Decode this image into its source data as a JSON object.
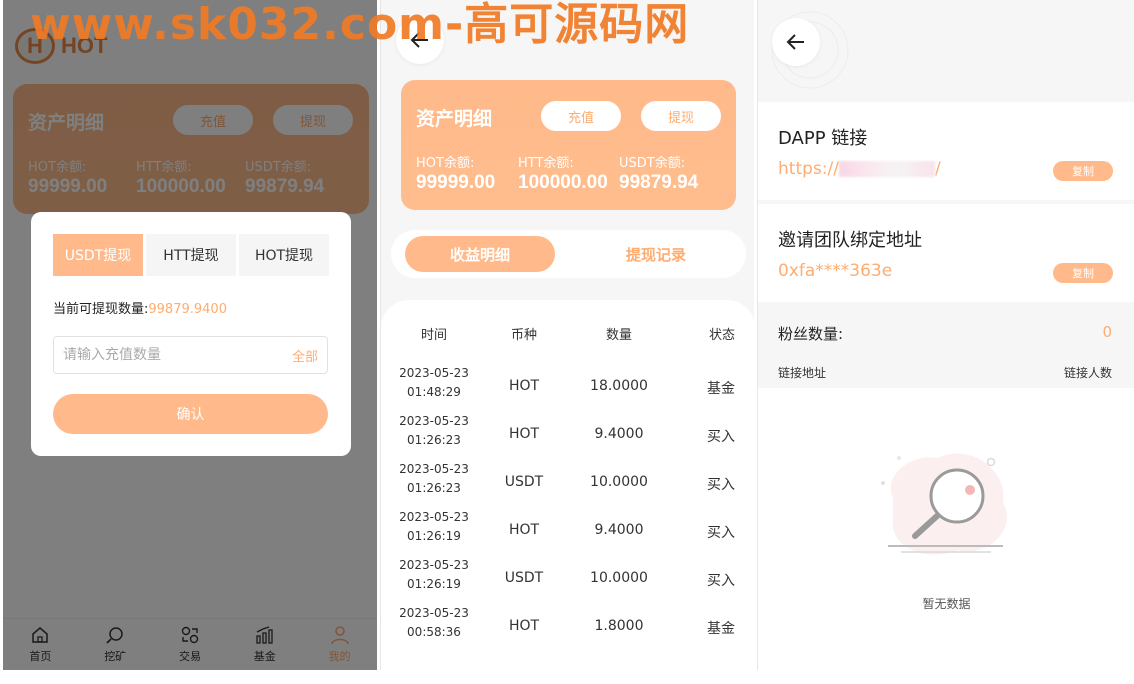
{
  "watermark": "www.sk032.com-高可源码网",
  "logo": {
    "mark": "H",
    "text": "HOT"
  },
  "assets": {
    "title": "资产明细",
    "recharge_label": "充值",
    "withdraw_label": "提现",
    "balances": [
      {
        "label": "HOT余额:",
        "value": "99999.00"
      },
      {
        "label": "HTT余额:",
        "value": "100000.00"
      },
      {
        "label": "USDT余额:",
        "value": "99879.94"
      }
    ]
  },
  "modal": {
    "tabs": [
      {
        "label": "USDT提现",
        "active": true
      },
      {
        "label": "HTT提现",
        "active": false
      },
      {
        "label": "HOT提现",
        "active": false
      }
    ],
    "available_label": "当前可提现数量:",
    "available_value": "99879.9400",
    "input_placeholder": "请输入充值数量",
    "all_label": "全部",
    "confirm_label": "确认"
  },
  "tabbar": [
    {
      "label": "首页",
      "icon": "home-icon",
      "active": false
    },
    {
      "label": "挖矿",
      "icon": "mining-icon",
      "active": false
    },
    {
      "label": "交易",
      "icon": "exchange-icon",
      "active": false
    },
    {
      "label": "基金",
      "icon": "fund-chart-icon",
      "active": false
    },
    {
      "label": "我的",
      "icon": "user-icon",
      "active": true
    }
  ],
  "records": {
    "segment_active": "收益明细",
    "segment_other": "提现记录",
    "headers": {
      "time": "时间",
      "coin": "币种",
      "amount": "数量",
      "status": "状态"
    },
    "rows": [
      {
        "date": "2023-05-23",
        "time": "01:48:29",
        "coin": "HOT",
        "amount": "18.0000",
        "status": "基金"
      },
      {
        "date": "2023-05-23",
        "time": "01:26:23",
        "coin": "HOT",
        "amount": "9.4000",
        "status": "买入"
      },
      {
        "date": "2023-05-23",
        "time": "01:26:23",
        "coin": "USDT",
        "amount": "10.0000",
        "status": "买入"
      },
      {
        "date": "2023-05-23",
        "time": "01:26:19",
        "coin": "HOT",
        "amount": "9.4000",
        "status": "买入"
      },
      {
        "date": "2023-05-23",
        "time": "01:26:19",
        "coin": "USDT",
        "amount": "10.0000",
        "status": "买入"
      },
      {
        "date": "2023-05-23",
        "time": "00:58:36",
        "coin": "HOT",
        "amount": "1.8000",
        "status": "基金"
      }
    ]
  },
  "invite": {
    "dapp_title": "DAPP 链接",
    "dapp_link_prefix": "https://",
    "dapp_link_suffix": "/",
    "copy_label": "复制",
    "team_title": "邀请团队绑定地址",
    "team_address": "0xfa****363e",
    "fans_label": "粉丝数量:",
    "fans_count": "0",
    "col_link": "链接地址",
    "col_people": "链接人数",
    "empty_text": "暂无数据"
  },
  "colors": {
    "accent": "#ffac70",
    "card": "#ffb98a"
  }
}
